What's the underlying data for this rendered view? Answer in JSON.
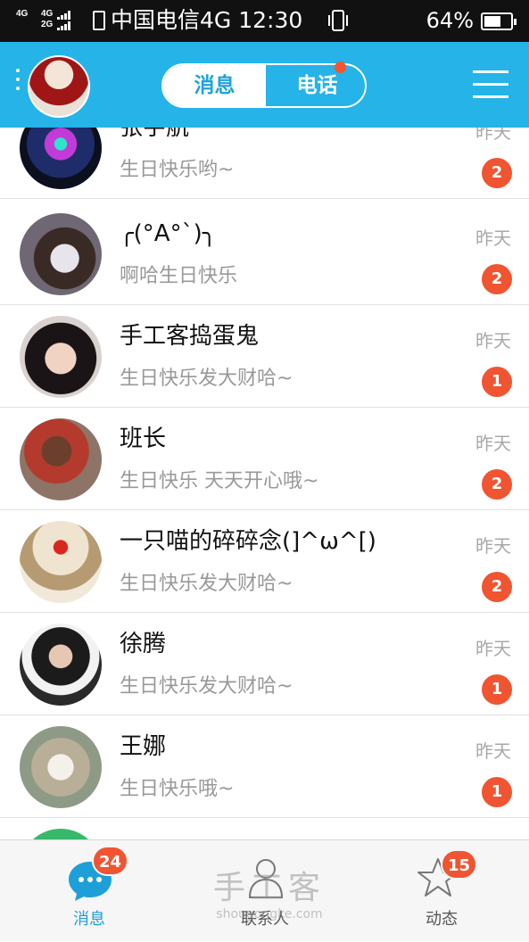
{
  "status_bar": {
    "network_left": "4G",
    "network_mid_top": "4G",
    "network_mid_bottom": "2G",
    "carrier": "中国电信4G",
    "time": "12:30",
    "battery_percent": "64%",
    "battery_level": 0.64
  },
  "header": {
    "tab_messages": "消息",
    "tab_calls": "电话",
    "accent_color": "#26b3e8"
  },
  "conversations": [
    {
      "name": "张宇航",
      "message": "生日快乐哟~",
      "time": "昨天",
      "unread": "2"
    },
    {
      "name": "╭(°A°`)╮",
      "message": "啊哈生日快乐",
      "time": "昨天",
      "unread": "2"
    },
    {
      "name": "手工客捣蛋鬼",
      "message": "生日快乐发大财哈~",
      "time": "昨天",
      "unread": "1"
    },
    {
      "name": "班长",
      "message": "生日快乐 天天开心哦~",
      "time": "昨天",
      "unread": "2"
    },
    {
      "name": "一只喵的碎碎念(]^ω^[)",
      "message": "生日快乐发大财哈~",
      "time": "昨天",
      "unread": "2"
    },
    {
      "name": "徐腾",
      "message": "生日快乐发大财哈~",
      "time": "昨天",
      "unread": "1"
    },
    {
      "name": "王娜",
      "message": "生日快乐哦~",
      "time": "昨天",
      "unread": "1"
    }
  ],
  "tab_bar": {
    "messages": {
      "label": "消息",
      "badge": "24"
    },
    "contacts": {
      "label": "联系人"
    },
    "moments": {
      "label": "动态",
      "badge": "15"
    }
  },
  "watermark": {
    "text": "手工客",
    "url": "shougongke.com"
  }
}
